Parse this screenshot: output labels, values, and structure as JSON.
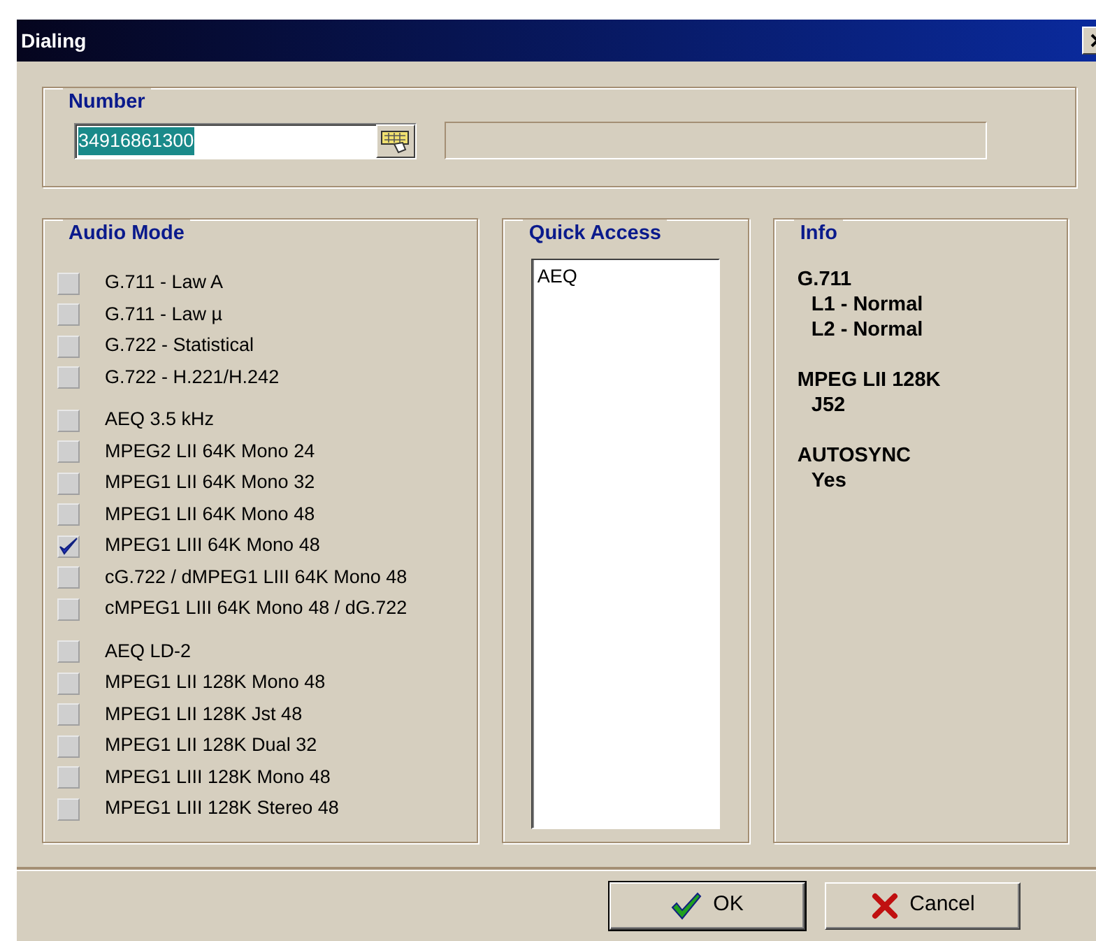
{
  "window": {
    "title": "Dialing"
  },
  "number": {
    "title": "Number",
    "value": "34916861300",
    "selected_all": true
  },
  "audio_mode": {
    "title": "Audio Mode",
    "groups": [
      [
        {
          "label": "G.711 - Law A",
          "checked": false
        },
        {
          "label": "G.711 - Law µ",
          "checked": false
        },
        {
          "label": "G.722 - Statistical",
          "checked": false
        },
        {
          "label": "G.722 - H.221/H.242",
          "checked": false
        }
      ],
      [
        {
          "label": "AEQ 3.5 kHz",
          "checked": false
        },
        {
          "label": "MPEG2 LII 64K Mono 24",
          "checked": false
        },
        {
          "label": "MPEG1 LII 64K Mono 32",
          "checked": false
        },
        {
          "label": "MPEG1 LII 64K Mono 48",
          "checked": false
        },
        {
          "label": "MPEG1 LIII 64K Mono 48",
          "checked": true
        },
        {
          "label": "cG.722 / dMPEG1 LIII 64K Mono 48",
          "checked": false
        },
        {
          "label": "cMPEG1 LIII 64K Mono 48 / dG.722",
          "checked": false
        }
      ],
      [
        {
          "label": "AEQ LD-2",
          "checked": false
        },
        {
          "label": "MPEG1 LII 128K Mono 48",
          "checked": false
        },
        {
          "label": "MPEG1 LII 128K Jst 48",
          "checked": false
        },
        {
          "label": "MPEG1 LII 128K Dual 32",
          "checked": false
        },
        {
          "label": "MPEG1 LIII 128K Mono 48",
          "checked": false
        },
        {
          "label": "MPEG1 LIII 128K Stereo 48",
          "checked": false
        }
      ]
    ]
  },
  "quick_access": {
    "title": "Quick Access",
    "items": [
      "AEQ"
    ]
  },
  "info": {
    "title": "Info",
    "blocks": [
      {
        "heading": "G.711",
        "lines": [
          "L1 - Normal",
          "L2 - Normal"
        ]
      },
      {
        "heading": "MPEG LII 128K",
        "lines": [
          "J52"
        ]
      },
      {
        "heading": "AUTOSYNC",
        "lines": [
          "Yes"
        ]
      }
    ]
  },
  "buttons": [
    {
      "kind": "ok",
      "label": "OK"
    },
    {
      "kind": "cancel",
      "label": "Cancel"
    }
  ]
}
